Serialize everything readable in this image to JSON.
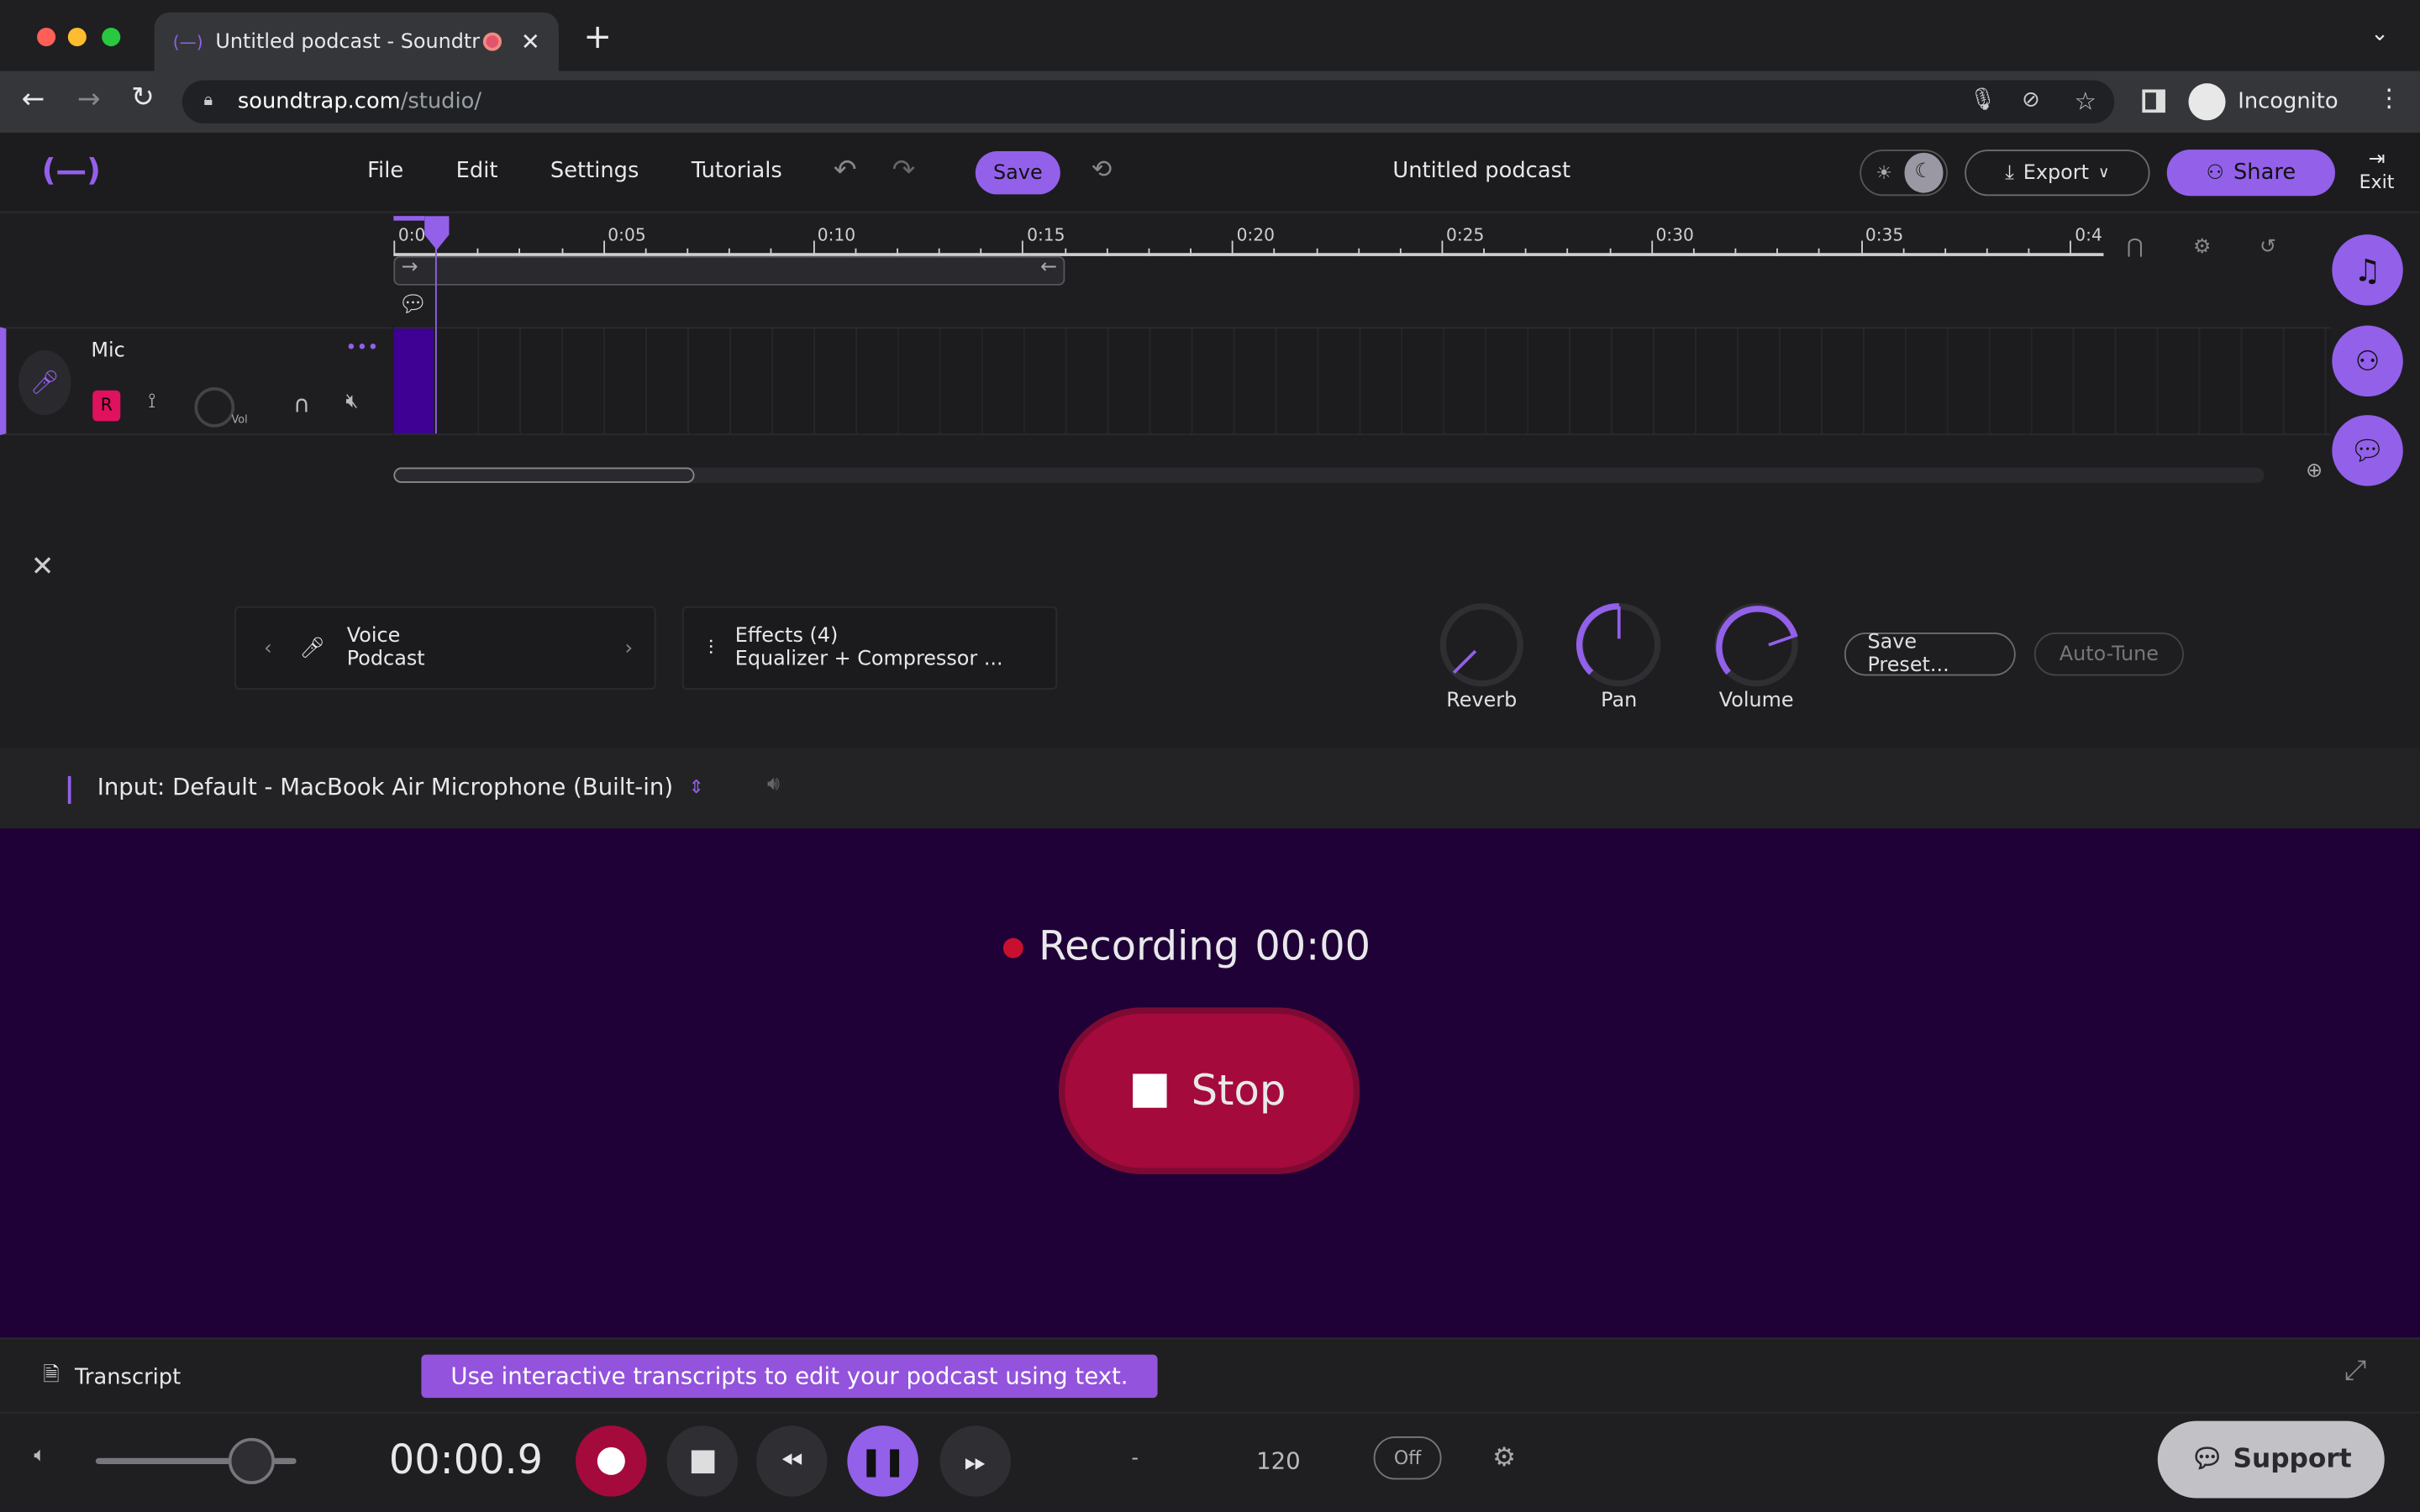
{
  "browser": {
    "tab_title": "Untitled podcast - Soundtr",
    "new_tab": "+",
    "url_host": "soundtrap.com",
    "url_path": "/studio/",
    "profile": "Incognito"
  },
  "toolbar": {
    "menu": [
      "File",
      "Edit",
      "Settings",
      "Tutorials"
    ],
    "save_label": "Save",
    "project_title": "Untitled podcast",
    "export_label": "Export",
    "share_label": "Share",
    "exit_label": "Exit",
    "theme": "dark"
  },
  "timeline": {
    "ticks": [
      "0:0",
      "0:05",
      "0:10",
      "0:15",
      "0:20",
      "0:25",
      "0:30",
      "0:35",
      "0:4"
    ]
  },
  "track": {
    "name": "Mic",
    "record_label": "R",
    "vol_label": "Vol",
    "more": "•••"
  },
  "instrument_panel": {
    "preset_category": "Voice",
    "preset_name": "Podcast",
    "effects_title": "Effects (4)",
    "effects_list": "Equalizer + Compressor ...",
    "knobs": [
      {
        "label": "Reverb"
      },
      {
        "label": "Pan"
      },
      {
        "label": "Volume"
      }
    ],
    "save_preset": "Save Preset...",
    "autotune": "Auto-Tune",
    "input_label": "Input: Default - MacBook Air Microphone (Built-in)"
  },
  "recording": {
    "status": "Recording",
    "time": "00:00",
    "stop_label": "Stop"
  },
  "transcript": {
    "label": "Transcript",
    "banner": "Use interactive transcripts to edit your podcast using text."
  },
  "transport": {
    "time": "00:00.9",
    "key": "-",
    "tempo": "120",
    "metronome": "Off",
    "support_label": "Support"
  },
  "colors": {
    "accent": "#9360ea",
    "record": "#a50a3c",
    "recording_bg": "#1f0037"
  }
}
